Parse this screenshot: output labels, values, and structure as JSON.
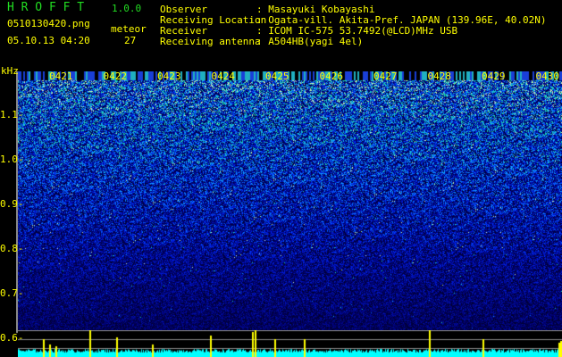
{
  "header": {
    "app_title": "H R O F F T",
    "version": "1.0.0",
    "filename": "0510130420.png",
    "datetime": "05.10.13 04:20",
    "meteor_label": "meteor",
    "meteor_count": "27"
  },
  "info": [
    {
      "key": "Observer",
      "value": ": Masayuki Kobayashi"
    },
    {
      "key": "Receiving Location",
      "value": ": Ogata-vill. Akita-Pref. JAPAN (139.96E, 40.02N)"
    },
    {
      "key": "Receiver",
      "value": ": ICOM IC-575 53.7492(@LCD)MHz USB"
    },
    {
      "key": "Receiving antenna",
      "value": ": A504HB(yagi 4el)"
    }
  ],
  "spectrogram": {
    "y_unit": "kHz",
    "y_ticks": [
      "1.1",
      "1.0",
      "0.9",
      "0.8",
      "0.7",
      "0.6"
    ],
    "time_labels": [
      "0421",
      "0422",
      "0423",
      "0424",
      "0425",
      "0426",
      "0427",
      "0428",
      "0429",
      "0430"
    ]
  },
  "colors": {
    "label": "#ffff00",
    "title": "#22dd22",
    "histogram": "#00ffff",
    "spike": "#ffff00"
  }
}
